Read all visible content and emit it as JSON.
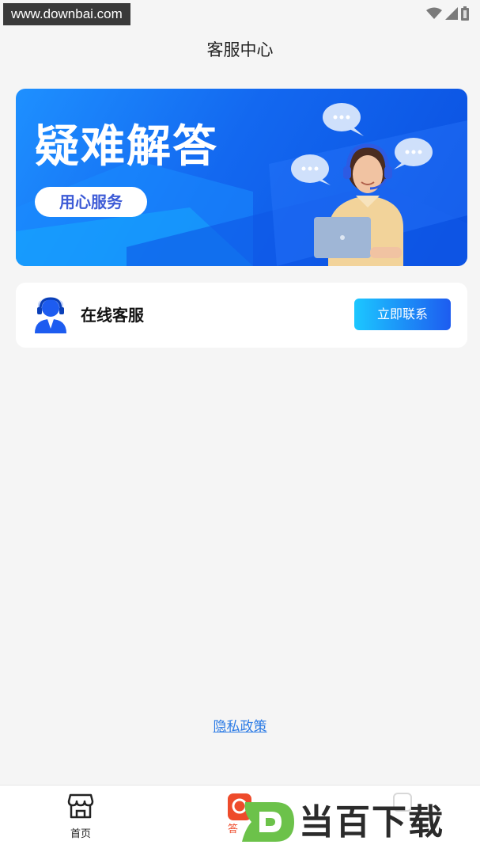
{
  "status_bar": {
    "watermark_url": "www.downbai.com"
  },
  "header": {
    "title": "客服中心"
  },
  "banner": {
    "title": "疑难解答",
    "pill": "用心服务"
  },
  "service": {
    "label": "在线客服",
    "button": "立即联系"
  },
  "footer": {
    "privacy_link": "隐私政策"
  },
  "bottom_nav": {
    "home_label": "首页",
    "second_label_partial": "答"
  },
  "watermark_logo": {
    "text": "当百下载"
  },
  "colors": {
    "accent": "#1d5cf0",
    "banner_blue": "#1368f0",
    "link": "#2c7be5",
    "background": "#f5f5f5"
  }
}
